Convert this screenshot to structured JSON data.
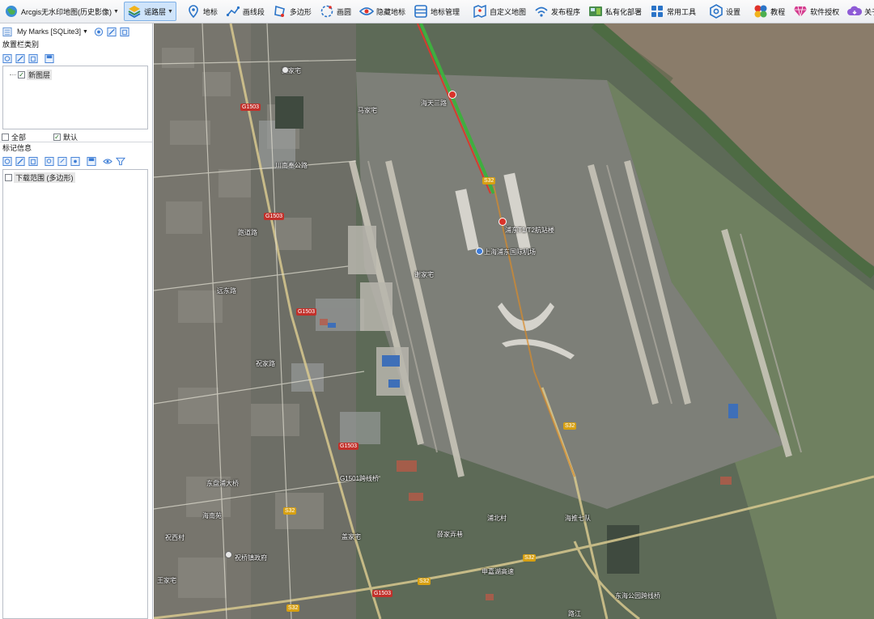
{
  "toolbar": {
    "app_label": "Arcgis无水印地图(历史影像)",
    "layer_label": "谣路层",
    "items": [
      {
        "label": "地标",
        "icon": "map-pin-icon"
      },
      {
        "label": "画线段",
        "icon": "polyline-icon"
      },
      {
        "label": "多边形",
        "icon": "polygon-icon"
      },
      {
        "label": "画圆",
        "icon": "circle-draw-icon"
      },
      {
        "label": "隐藏地标",
        "icon": "eye-icon"
      },
      {
        "label": "地标管理",
        "icon": "list-icon"
      },
      {
        "label": "自定义地图",
        "icon": "custom-map-icon"
      },
      {
        "label": "发布程序",
        "icon": "wifi-icon"
      },
      {
        "label": "私有化部署",
        "icon": "server-icon"
      },
      {
        "label": "常用工具",
        "icon": "grid-icon"
      },
      {
        "label": "设置",
        "icon": "settings-icon"
      },
      {
        "label": "教程",
        "icon": "pinwheel-icon"
      },
      {
        "label": "软件授权",
        "icon": "diamond-icon"
      },
      {
        "label": "关于软件",
        "icon": "cloud-icon"
      }
    ]
  },
  "left_panel": {
    "db_label": "My Marks [SQLite3]",
    "category_title": "放置栏类别",
    "tree_items": [
      {
        "label": "新图层",
        "checked": true
      }
    ],
    "check_all_label": "全部",
    "check_default_label": "默认",
    "check_all": false,
    "check_default": true,
    "mark_info_title": "标记信息",
    "mark_items": [
      {
        "label": "下载范围 (多边形)",
        "checked": false
      }
    ]
  },
  "map": {
    "place_labels": [
      "龚家宅",
      "马家宅",
      "海天三路",
      "浦东T1/T2航站楼",
      "上海浦东国际机场",
      "谢家宅",
      "G1501跨线桥",
      "东盘浦大桥",
      "浦北村",
      "海推七队",
      "薛家弄巷",
      "盖家宅",
      "祝桥镇政府",
      "海南苑",
      "祝西村",
      "王家宅",
      "申嘉湖高速",
      "东海公园跨线桥",
      "路江",
      "川南奉公路",
      "跑道路",
      "远东路",
      "祝家路"
    ],
    "road_badges": [
      "G1503",
      "G1503",
      "G1503",
      "G1503",
      "S32",
      "S32",
      "S32",
      "S32",
      "S32",
      "G1503",
      "S32"
    ]
  }
}
